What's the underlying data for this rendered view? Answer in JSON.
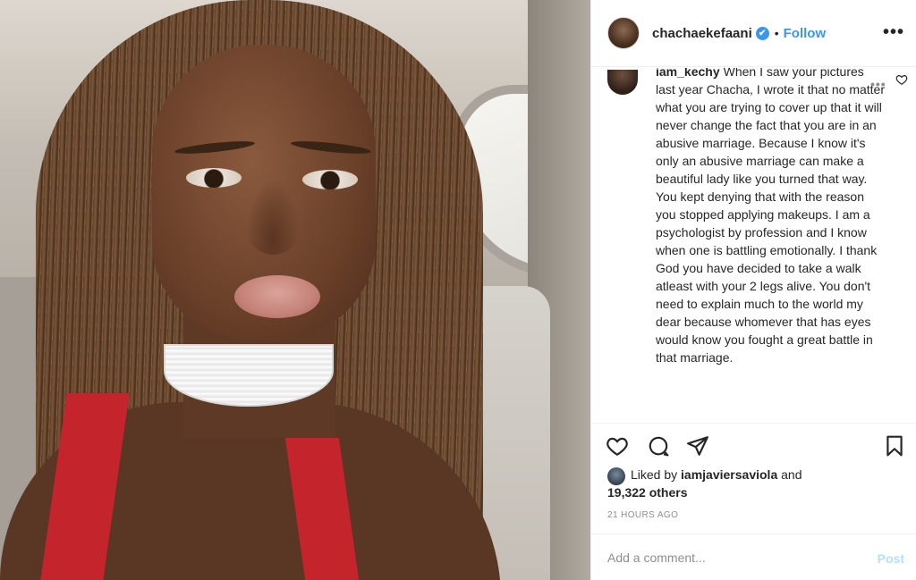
{
  "post": {
    "username": "chachaekefaani",
    "verified_badge": "✔",
    "separator": "•",
    "follow_label": "Follow",
    "more_label": "•••",
    "photo_alt": "selfie"
  },
  "comment": {
    "author": "iam_kechy",
    "text": "When I saw your pictures last year Chacha, I wrote it that no matter what you are trying to cover up that it will never change the fact that you are in an abusive marriage. Because I know it's only an abusive marriage can make a beautiful lady like you turned that way. You kept denying that with the reason you stopped applying makeups. I am a psychologist by profession and I know when one is battling emotionally. I thank God you have decided to take a walk atleast with your 2 legs alive. You don't need to explain much to the world my dear because whomever that has eyes would know you fought a great battle in that marriage.",
    "more_label": "•••"
  },
  "actions": {
    "icons": [
      "heart-icon",
      "comment-icon",
      "share-icon",
      "bookmark-icon"
    ]
  },
  "likes": {
    "prefix": "Liked by ",
    "by_user": "iamjaviersaviola",
    "suffix": " and",
    "others": "19,322 others"
  },
  "timestamp": "21 HOURS AGO",
  "add_comment": {
    "placeholder": "Add a comment...",
    "post_label": "Post"
  },
  "colors": {
    "accent": "#3897f0",
    "post_disabled": "#b2dffc",
    "muted": "#8e8e8e"
  }
}
